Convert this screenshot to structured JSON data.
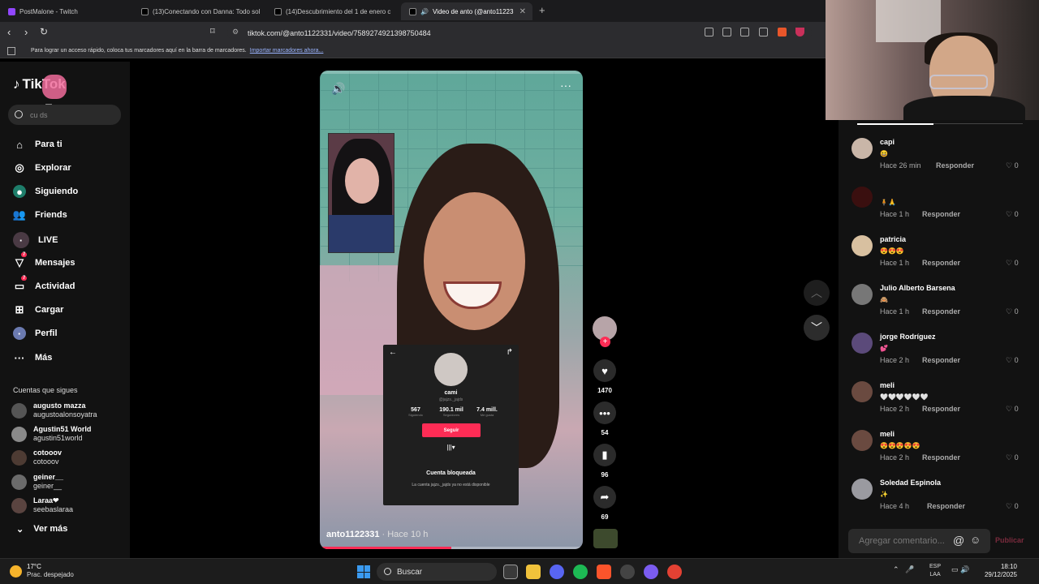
{
  "browser": {
    "tabs": [
      {
        "title": "PostMalone - Twitch"
      },
      {
        "title": "(13)Conectando con Danna: Todo sol"
      },
      {
        "title": "(14)Descubrimiento del 1 de enero c"
      },
      {
        "title": "Video de anto (@anto11223"
      }
    ],
    "url": "tiktok.com/@anto1122331/video/7589274921398750484",
    "bookmarks_text": "Para lograr un acceso rápido, coloca tus marcadores aquí en la barra de marcadores.",
    "bookmarks_link": "Importar marcadores ahora..."
  },
  "sidebar": {
    "logo": "TikTok",
    "sticker_text": "x5",
    "search_placeholder": "cu    ds",
    "nav": [
      {
        "label": "Para ti",
        "icon": "home-icon"
      },
      {
        "label": "Explorar",
        "icon": "compass-icon"
      },
      {
        "label": "Siguiendo",
        "icon": "following-icon"
      },
      {
        "label": "Friends",
        "icon": "friends-icon"
      },
      {
        "label": "LIVE",
        "icon": "live-icon"
      },
      {
        "label": "Mensajes",
        "icon": "message-icon",
        "badge": "7"
      },
      {
        "label": "Actividad",
        "icon": "activity-icon",
        "badge": "7"
      },
      {
        "label": "Cargar",
        "icon": "upload-icon"
      },
      {
        "label": "Perfil",
        "icon": "profile-icon"
      },
      {
        "label": "Más",
        "icon": "more-icon"
      }
    ],
    "following_title": "Cuentas que sigues",
    "following": [
      {
        "name": "augusto mazza",
        "handle": "augustoalonsoyatra"
      },
      {
        "name": "Agustin51 World",
        "handle": "agustin51world"
      },
      {
        "name": "cotooov",
        "handle": "cotooov"
      },
      {
        "name": "geiner__",
        "handle": "geiner__"
      },
      {
        "name": "Laraa❤",
        "handle": "seebaslaraa"
      }
    ],
    "see_more": "Ver más"
  },
  "video": {
    "author": "anto1122331",
    "time": " · Hace 10 h",
    "progress": 0.5,
    "card": {
      "name": "cami",
      "handle": "@jajzs._jajds",
      "stats": [
        {
          "value": "567",
          "label": "Siguiendo"
        },
        {
          "value": "190.1 mil",
          "label": "Seguidores"
        },
        {
          "value": "7.4 mill.",
          "label": "Me gusta"
        }
      ],
      "follow_label": "Seguir",
      "tabs_glyph": "|||▾",
      "blocked_title": "Cuenta bloqueada",
      "blocked_text": "La cuenta jajzs._jajds ya no está disponible"
    },
    "actions": {
      "likes": "1470",
      "comments": "54",
      "saves": "96",
      "shares": "69"
    }
  },
  "comments": [
    {
      "user": "capi",
      "text": "😆",
      "time": "Hace 26 min",
      "reply": "Responder",
      "likes": "0"
    },
    {
      "user": "",
      "text": "🧍🙏",
      "time": "Hace 1 h",
      "reply": "Responder",
      "likes": "0"
    },
    {
      "user": "patricia",
      "text": "😍😍😍",
      "time": "Hace 1 h",
      "reply": "Responder",
      "likes": "0"
    },
    {
      "user": "Julio Alberto Barsena",
      "text": "🙈",
      "time": "Hace 1 h",
      "reply": "Responder",
      "likes": "0"
    },
    {
      "user": "jorge Rodríguez",
      "text": "💕",
      "time": "Hace 2 h",
      "reply": "Responder",
      "likes": "0"
    },
    {
      "user": "meli",
      "text": "🤍🤍🤍🤍🤍🤍",
      "time": "Hace 2 h",
      "reply": "Responder",
      "likes": "0"
    },
    {
      "user": "meli",
      "text": "😍😍😍😍😍",
      "time": "Hace 2 h",
      "reply": "Responder",
      "likes": "0"
    },
    {
      "user": "Soledad Espinola",
      "text": "✨",
      "time": "Hace 4 h",
      "reply": "Responder",
      "likes": "0"
    }
  ],
  "comment_input": {
    "placeholder": "Agregar comentario...",
    "publish": "Publicar"
  },
  "taskbar": {
    "temp": "17°C",
    "weather": "Prac. despejado",
    "search": "Buscar",
    "lang1": "ESP",
    "lang2": "LAA",
    "time": "18:10",
    "date": "29/12/2025"
  },
  "colors": {
    "accent": "#fe2c55",
    "background": "#121212"
  }
}
